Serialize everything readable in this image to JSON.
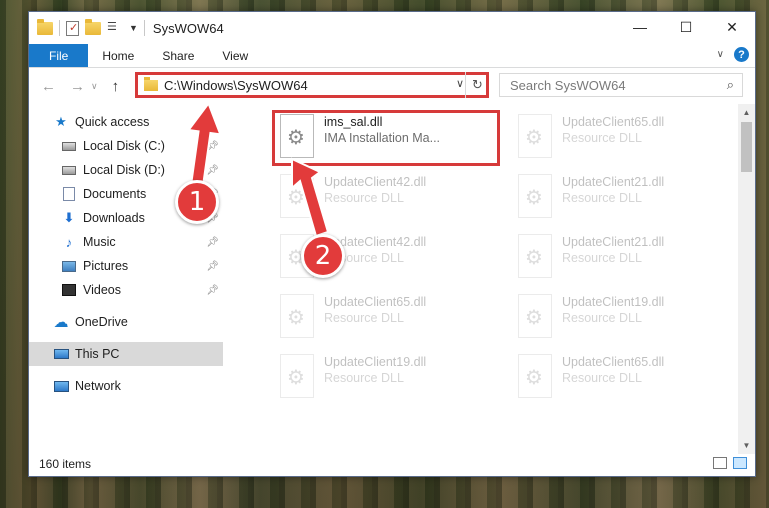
{
  "window": {
    "title": "SysWOW64",
    "controls": [
      "minimize",
      "maximize",
      "close"
    ]
  },
  "ribbon": {
    "tabs": [
      "File",
      "Home",
      "Share",
      "View"
    ]
  },
  "address": {
    "path": "C:\\Windows\\SysWOW64",
    "search_placeholder": "Search SysWOW64"
  },
  "navpane": {
    "quick_access": "Quick access",
    "items": [
      {
        "label": "Local Disk (C:)",
        "icon": "disk-icon",
        "pinned": true
      },
      {
        "label": "Local Disk (D:)",
        "icon": "disk-icon",
        "pinned": true
      },
      {
        "label": "Documents",
        "icon": "documents-icon",
        "pinned": true
      },
      {
        "label": "Downloads",
        "icon": "downloads-icon",
        "pinned": true
      },
      {
        "label": "Music",
        "icon": "music-icon",
        "pinned": true
      },
      {
        "label": "Pictures",
        "icon": "pictures-icon",
        "pinned": true
      },
      {
        "label": "Videos",
        "icon": "videos-icon",
        "pinned": true
      }
    ],
    "onedrive": "OneDrive",
    "this_pc": "This PC",
    "network": "Network"
  },
  "files": {
    "highlighted": {
      "name": "ims_sal.dll",
      "desc": "IMA Installation Ma..."
    },
    "background": [
      {
        "name": "UpdateClient65.dll",
        "desc": "Resource DLL"
      },
      {
        "name": "UpdateClient42.dll",
        "desc": "Resource DLL"
      },
      {
        "name": "UpdateClient21.dll",
        "desc": "Resource DLL"
      },
      {
        "name": "UpdateClient42.dll",
        "desc": "Resource DLL"
      },
      {
        "name": "UpdateClient21.dll",
        "desc": "Resource DLL"
      },
      {
        "name": "UpdateClient65.dll",
        "desc": "Resource DLL"
      },
      {
        "name": "UpdateClient19.dll",
        "desc": "Resource DLL"
      },
      {
        "name": "UpdateClient19.dll",
        "desc": "Resource DLL"
      },
      {
        "name": "UpdateClient65.dll",
        "desc": "Resource DLL"
      }
    ]
  },
  "status": {
    "count": "160 items"
  },
  "annotations": {
    "badge1": "1",
    "badge2": "2"
  },
  "colors": {
    "accent": "#1979ca",
    "annotation_red": "#d63a3a"
  }
}
